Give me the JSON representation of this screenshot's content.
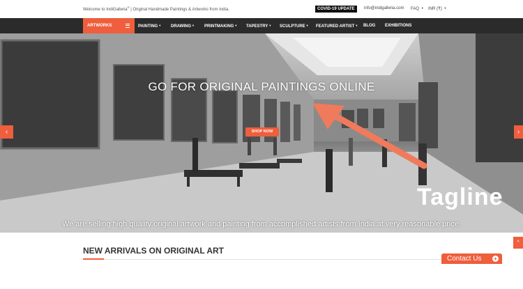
{
  "topbar": {
    "welcome_prefix": "Welcome to IndiGalleria",
    "welcome_reg": "®",
    "welcome_suffix": " | Original Handmade Paintings & Artworks from India.",
    "covid_label": "COVID-19 UPDATE",
    "email": "info@indigalleria.com",
    "faq_label": "FAQ",
    "currency_label": "INR (₹)"
  },
  "nav": {
    "artworks_label": "ARTWORKS",
    "items": [
      {
        "label": "PAINTING",
        "has_caret": true
      },
      {
        "label": "DRAWING",
        "has_caret": true
      },
      {
        "label": "PRINTMAKING",
        "has_caret": true
      },
      {
        "label": "TAPESTRY",
        "has_caret": true
      },
      {
        "label": "SCULPTURE",
        "has_caret": true
      },
      {
        "label": "FEATURED ARTIST",
        "has_caret": true
      },
      {
        "label": "BLOG",
        "has_caret": false
      },
      {
        "label": "EXHIBITIONS",
        "has_caret": false
      }
    ],
    "caret_glyph": "▼"
  },
  "hero": {
    "title": "GO FOR ORIGINAL PAINTINGS ONLINE",
    "shop_button": "SHOP NOW",
    "caption": "We are selling high quality original artwork and painting from accomplished artists from India at very reasonable price.",
    "prev_glyph": "‹",
    "next_glyph": "›",
    "annotation_label": "Tagline",
    "annotation_color": "#f07a5c"
  },
  "sections": {
    "new_arrivals_title": "NEW ARRIVALS ON ORIGINAL ART"
  },
  "widgets": {
    "contact_label": "Contact Us",
    "contact_plus": "+",
    "scroll_top_glyph": "^"
  },
  "colors": {
    "accent": "#ef5e3d",
    "nav_bg": "#2b2b2b"
  }
}
